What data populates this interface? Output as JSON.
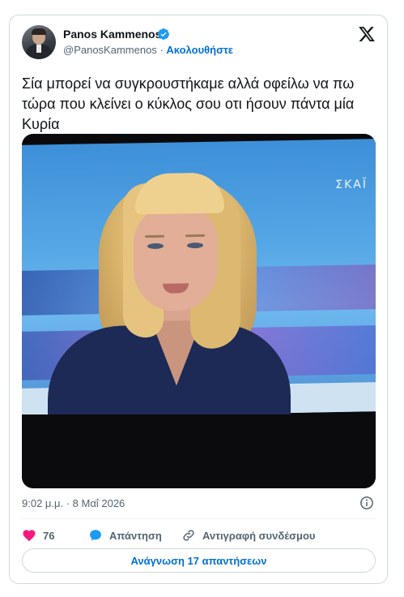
{
  "author": {
    "name": "Panos Kammenos",
    "handle": "@PanosKammenos",
    "separator": "·",
    "follow_label": "Ακολουθήστε"
  },
  "tweet": {
    "text": "Σία μπορεί να συγκρουστήκαμε αλλά οφείλω να πω τώρα που κλείνει ο κύκλος σου οτι ήσουν πάντα μία Κυρία",
    "media_channel_logo": "ΣΚΑΪ",
    "timestamp": "9:02 μ.μ. · 8 Μαΐ 2026"
  },
  "actions": {
    "like_count": "76",
    "reply_label": "Απάντηση",
    "copy_link_label": "Αντιγραφή συνδέσμου",
    "read_replies_label": "Ανάγνωση 17 απαντήσεων"
  },
  "icons": {
    "verified": "verified-badge-icon",
    "brand": "x-logo-icon",
    "info": "info-icon",
    "like": "heart-icon",
    "reply": "reply-bubble-icon",
    "copy": "link-icon"
  },
  "colors": {
    "accent": "#1d9bf0",
    "link_blue": "#006fd6",
    "like_pink": "#f91880",
    "muted_text": "#536471",
    "border": "#cfd9de"
  }
}
